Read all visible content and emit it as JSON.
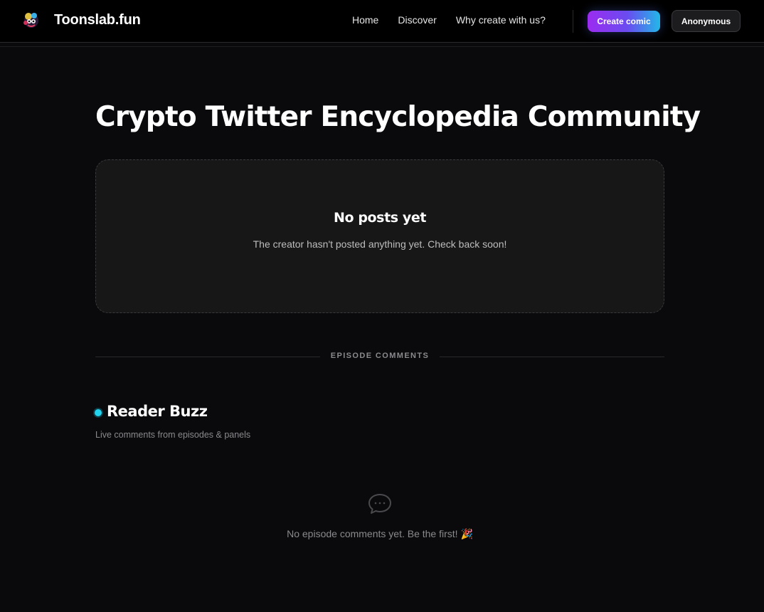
{
  "header": {
    "brand": "Toonslab.fun",
    "logo_icon": "mascot-logo-icon",
    "nav": [
      "Home",
      "Discover",
      "Why create with us?"
    ],
    "create_button": "Create comic",
    "user_button": "Anonymous",
    "accent_gradient": [
      "#9b2cf0",
      "#22b8e8"
    ]
  },
  "main": {
    "title": "Crypto Twitter Encyclopedia Community",
    "empty_posts": {
      "title": "No posts yet",
      "subtitle": "The creator hasn't posted anything yet. Check back soon!"
    },
    "section_label": "EPISODE COMMENTS",
    "buzz": {
      "title": "Reader Buzz",
      "subtitle": "Live comments from episodes & panels",
      "dot_color": "#22d3ee"
    },
    "comments_empty": {
      "icon": "chat-bubble-icon",
      "text": "No episode comments yet. Be the first! 🎉"
    }
  }
}
